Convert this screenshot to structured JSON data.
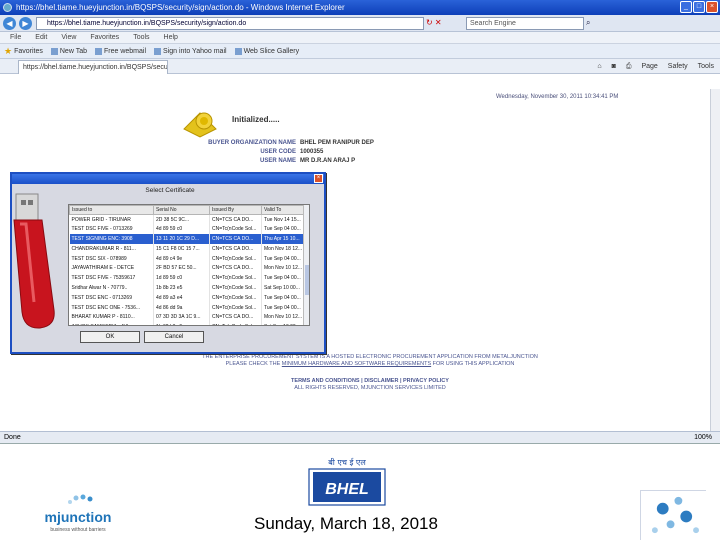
{
  "browser": {
    "title": "https://bhel.tiame.hueyjunction.in/BQSPS/security/sign/action.do - Windows Internet Explorer",
    "address": "https://bhel.tiame.hueyjunction.in/BQSPS/security/sign/action.do",
    "search_placeholder": "Search Engine",
    "menu": [
      "File",
      "Edit",
      "View",
      "Favorites",
      "Tools",
      "Help"
    ],
    "favorites_label": "Favorites",
    "favorites": [
      "New Tab",
      "Free webmail",
      "Sign into Yahoo mail",
      "Web Slice Gallery"
    ],
    "tab_label": "https://bhel.tiame.hueyjunction.in/BQSPS/securit...",
    "commands": [
      "Page",
      "Safety",
      "Tools"
    ],
    "status_left": "Done",
    "status_right": "100%"
  },
  "page": {
    "datetime": "Wednesday, November 30, 2011 10:34:41 PM",
    "initialized": "Initialized.....",
    "buyer_org_label": "BUYER ORGANIZATION NAME",
    "buyer_org_value": "BHEL PEM RANIPUR DEP",
    "user_code_label": "USER CODE",
    "user_code_value": "1000355",
    "user_name_label": "USER NAME",
    "user_name_value": "MR D.R.AN ARAJ P",
    "footer_line1": "THE ENTERPRISE PROCUREMENT SYSTEM IS A HOSTED ELECTRONIC PROCUREMENT APPLICATION FROM METALJUNCTION",
    "footer_line2_pre": "PLEASE CHECK THE",
    "footer_line2_link": "MINIMUM HARDWARE AND SOFTWARE REQUIREMENTS",
    "footer_line2_post": "FOR USING THIS APPLICATION",
    "footer_links": "TERMS AND CONDITIONS | DISCLAIMER | PRIVACY POLICY",
    "footer_copyright": "ALL RIGHTS RESERVED, MJUNCTION SERVICES LIMITED"
  },
  "dialog": {
    "title": "Select Certificate",
    "columns": [
      "Issued to",
      "Serial No",
      "Issued By",
      "Valid To"
    ],
    "rows": [
      [
        "POWER GRID - TIRUNAR",
        "2D 38 5C 9C...",
        "CN=TCS CA DO...",
        "Tue Nov 14 15..."
      ],
      [
        "TEST DSC FIVE - 0713269",
        "4d 89 59 c0",
        "CN=Tc(nCode Sol...",
        "Tue Sep 04 00..."
      ],
      [
        "TEST SIGNING ENC: 3908",
        "13 11 20 1C 29 D...",
        "CN=TCS CA DO...",
        "Thu Apr 15 10..."
      ],
      [
        "CHANDRAKUMAR R - 811...",
        "15 C1 F8 0C 15 7...",
        "CN=TCS CA DO...",
        "Mon Nov 18 12..."
      ],
      [
        "TEST DSC SIX - 078989",
        "4d 89 c4 9e",
        "CN=Tc(nCode Sol...",
        "Tue Sep 04 00..."
      ],
      [
        "JAYAVATHIRAM E - DETCE",
        "2F BD 57 EC 50...",
        "CN=TCS CA DO...",
        "Mon Nov 10 12..."
      ],
      [
        "TEST DSC FIVE - 75359617",
        "1d 89 59 c0",
        "CN=Tc(nCode Sol...",
        "Tue Sep 04 00..."
      ],
      [
        "Sridhar Alwar N - 70779..",
        "1b 8b 23 e5",
        "CN=Tc(nCode Sol...",
        "Sat Sep 10 00..."
      ],
      [
        "TEST DSC ENC - 0713269",
        "4d 89 a3 e4",
        "CN=Tc(nCode Sol...",
        "Tue Sep 04 00..."
      ],
      [
        "TEST DSC ENC ONE - 7536...",
        "4d 86 dd 9a",
        "CN=Tc(nCode Sol...",
        "Tue Sep 04 00..."
      ],
      [
        "BHARAT KUMAR P - 8110...",
        "07 3D 3D 3A 1C 9...",
        "CN=TCS CA DO...",
        "Mon Nov 10 12..."
      ],
      [
        "ASHOK SANWARIA - JUL...",
        "1b 62 b3 c9",
        "CN=Tc(nCode Sol...",
        "Sat Sep 10 00..."
      ]
    ],
    "selected_index": 2,
    "ok_label": "OK",
    "cancel_label": "Cancel"
  },
  "slide": {
    "date": "Sunday, March 18, 2018",
    "bhel_hindi": "बी एच ई एल",
    "bhel_logo_text": "BHEL",
    "mjunction_logo_text": "mjunction",
    "mjunction_tagline": "business without barriers"
  },
  "colors": {
    "ie_blue": "#1a50c8",
    "page_label": "#4a5590",
    "selected_row": "#2a5fcf",
    "usb_red": "#c8141e",
    "bhel_blue": "#1b4aa0",
    "mj_blue": "#3aa0d8"
  }
}
